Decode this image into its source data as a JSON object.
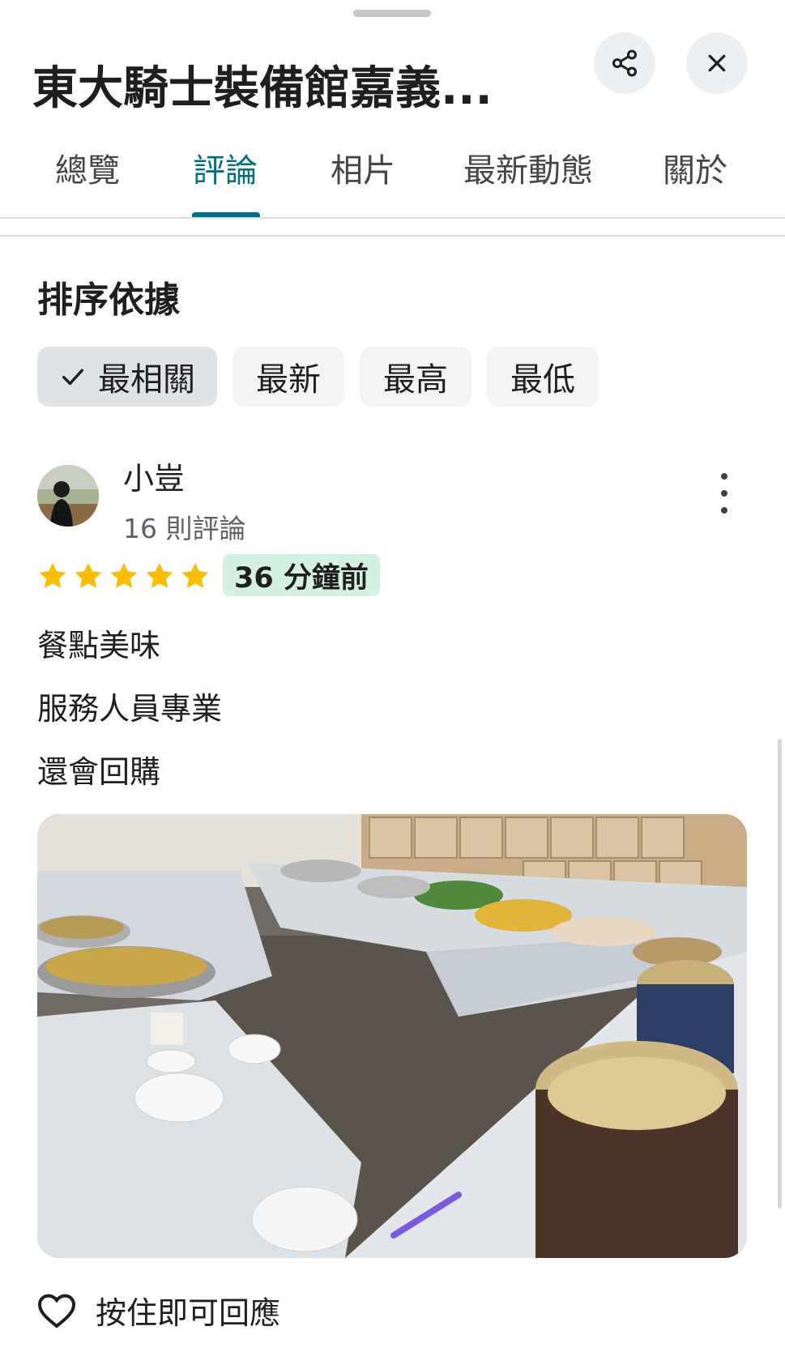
{
  "place": {
    "title": "東大騎士裝備館嘉義..."
  },
  "tabs": [
    {
      "label": "總覽"
    },
    {
      "label": "評論"
    },
    {
      "label": "相片"
    },
    {
      "label": "最新動態"
    },
    {
      "label": "關於"
    }
  ],
  "active_tab": "評論",
  "sort": {
    "heading": "排序依據",
    "options": [
      {
        "label": "最相關"
      },
      {
        "label": "最新"
      },
      {
        "label": "最高"
      },
      {
        "label": "最低"
      }
    ],
    "selected": "最相關"
  },
  "review": {
    "author": "小豈",
    "author_review_count": "16 則評論",
    "rating": 5,
    "rating_max": 5,
    "time_ago": "36 分鐘前",
    "lines": [
      "餐點美味",
      "服務人員專業",
      "還會回購"
    ]
  },
  "reaction": {
    "label": "按住即可回應"
  },
  "colors": {
    "accent": "#00727d",
    "star": "#fbbc04",
    "badge_bg": "#d3f2e0",
    "chip_bg": "#f1f3f4",
    "chip_selected_bg": "#dfe3e7"
  }
}
